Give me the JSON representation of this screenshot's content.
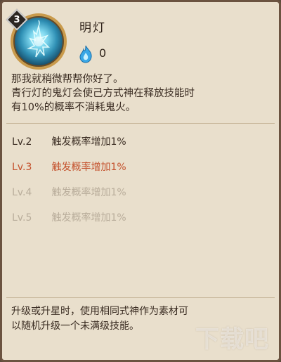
{
  "skill": {
    "name": "明灯",
    "badge_level": "3",
    "cost_value": "0",
    "icon": "blue-lantern-skill-icon",
    "cost_icon": "blue-ghost-flame-icon"
  },
  "description_lines": [
    "那我就稍微帮帮你好了。",
    "青行灯的鬼灯会使己方式神在释放技能时",
    "有10%的概率不消耗鬼火。"
  ],
  "levels": [
    {
      "lv": "Lv.2",
      "text": "触发概率增加1%",
      "state": "done"
    },
    {
      "lv": "Lv.3",
      "text": "触发概率增加1%",
      "state": "current"
    },
    {
      "lv": "Lv.4",
      "text": "触发概率增加1%",
      "state": "locked"
    },
    {
      "lv": "Lv.5",
      "text": "触发概率增加1%",
      "state": "locked"
    }
  ],
  "footer_lines": [
    "升级或升星时，使用相同式神作为素材可",
    "以随机升级一个未满级技能。"
  ],
  "watermark": "下载吧",
  "colors": {
    "panel_bg": "#e9dfcc",
    "current_level": "#c4502b",
    "locked_level": "#b9ad9b",
    "text": "#3a2c22"
  }
}
